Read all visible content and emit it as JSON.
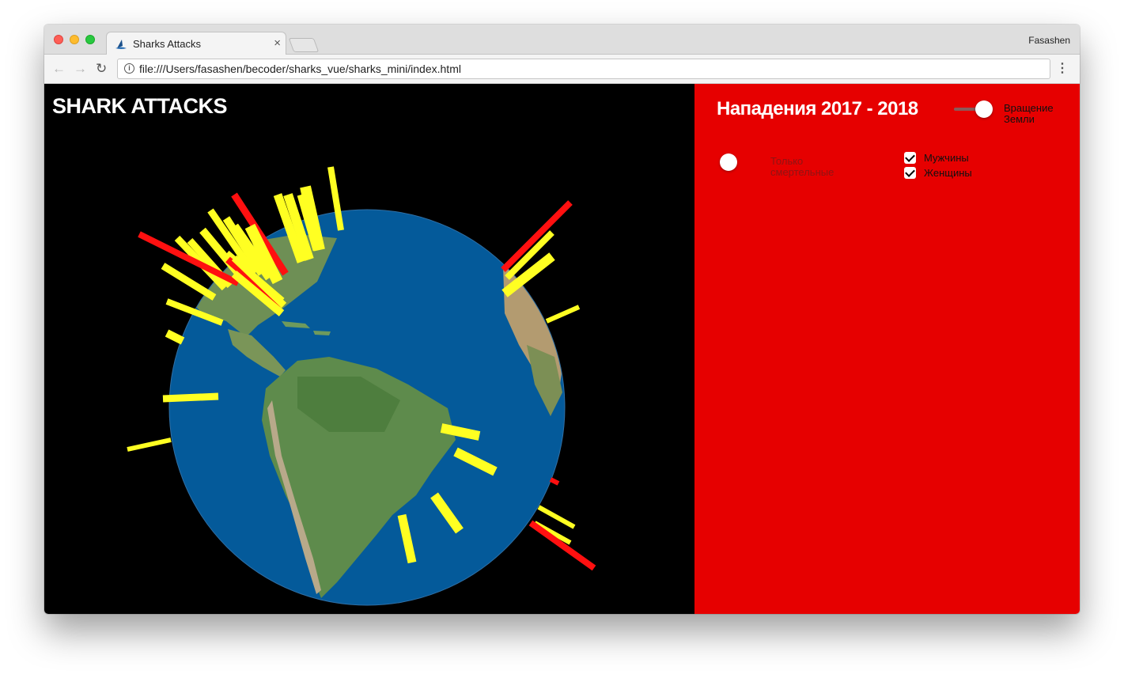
{
  "browser": {
    "tab_title": "Sharks Attacks",
    "tab_close": "×",
    "profile_name": "Fasashen",
    "url": "file:///Users/fasashen/becoder/sharks_vue/sharks_mini/index.html",
    "nav": {
      "back": "←",
      "forward": "→",
      "reload": "↻",
      "info": "i",
      "menu": "⋮"
    }
  },
  "app": {
    "title": "SHARK ATTACKS",
    "period_title": "Нападения 2017 - 2018",
    "controls": {
      "rotate_label": "Вращение Земли",
      "rotate_on": true,
      "fatal_only_label": "Только смертельные",
      "fatal_only_on": false,
      "men_label": "Мужчины",
      "men_checked": true,
      "women_label": "Женщины",
      "women_checked": true
    },
    "colors": {
      "panel_background": "#e60000",
      "nonfatal_attack_bar": "#ffff22",
      "fatal_attack_bar": "#ff1010",
      "ocean": "#045a9a",
      "land": "#5f8a50"
    }
  }
}
